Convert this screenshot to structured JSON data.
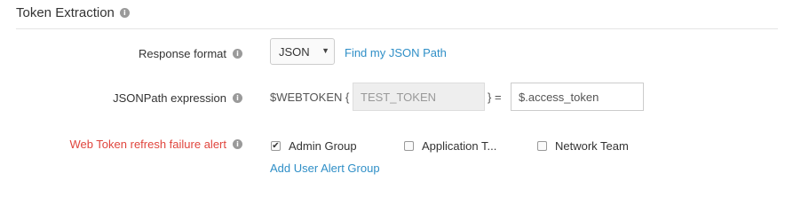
{
  "section": {
    "title": "Token Extraction",
    "info_icon": "info-icon"
  },
  "response_format": {
    "label": "Response format",
    "selected": "JSON",
    "find_link": "Find my JSON Path"
  },
  "jsonpath": {
    "label": "JSONPath expression",
    "prefix": "$WEBTOKEN {",
    "token_value": "TEST_TOKEN",
    "suffix": "} =",
    "path_value": "$.access_token"
  },
  "alert": {
    "label": "Web Token refresh failure alert",
    "label_color": "#e0453d",
    "groups": [
      {
        "label": "Admin Group",
        "checked": true
      },
      {
        "label": "Application T...",
        "checked": false
      },
      {
        "label": "Network Team",
        "checked": false
      }
    ],
    "add_link": "Add User Alert Group"
  },
  "colors": {
    "link": "#2f8fc7",
    "alert": "#e0453d"
  }
}
